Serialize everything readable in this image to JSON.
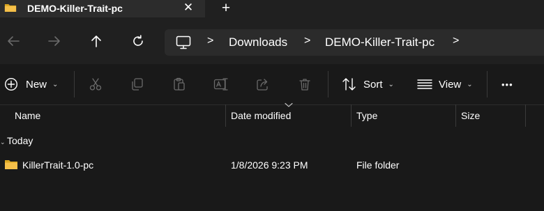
{
  "window": {
    "tab_title": "DEMO-Killer-Trait-pc",
    "tab_close": "✕",
    "new_tab": "+"
  },
  "nav": {
    "icons": [
      "back-arrow-icon",
      "forward-arrow-icon",
      "up-arrow-icon",
      "refresh-icon"
    ]
  },
  "address": {
    "root_icon": "monitor-icon",
    "separators": [
      ">",
      ">",
      ">"
    ],
    "crumbs": [
      "Downloads",
      "DEMO-Killer-Trait-pc"
    ]
  },
  "toolbar": {
    "new_label": "New",
    "sort_label": "Sort",
    "view_label": "View",
    "more_label": "•••",
    "chevron": "⌄",
    "icons": [
      "new-plus-icon",
      "cut-icon",
      "copy-icon",
      "paste-icon",
      "rename-icon",
      "share-icon",
      "delete-icon",
      "sort-icon",
      "view-icon",
      "more-icon"
    ]
  },
  "columns": [
    "Name",
    "Date modified",
    "Type",
    "Size"
  ],
  "groups": [
    {
      "label": "Today",
      "items": [
        {
          "name": "KillerTrait-1.0-pc",
          "date": "1/8/2026 9:23 PM",
          "type": "File folder",
          "size": ""
        }
      ]
    }
  ],
  "colors": {
    "background": "#191919",
    "chrome": "#202020",
    "tab_active": "#2c2c2c",
    "addressbar": "#2b2b2b",
    "folder_yellow": "#f5c04a",
    "folder_dark": "#d9a520",
    "disabled_icon": "#6b6b6b"
  }
}
